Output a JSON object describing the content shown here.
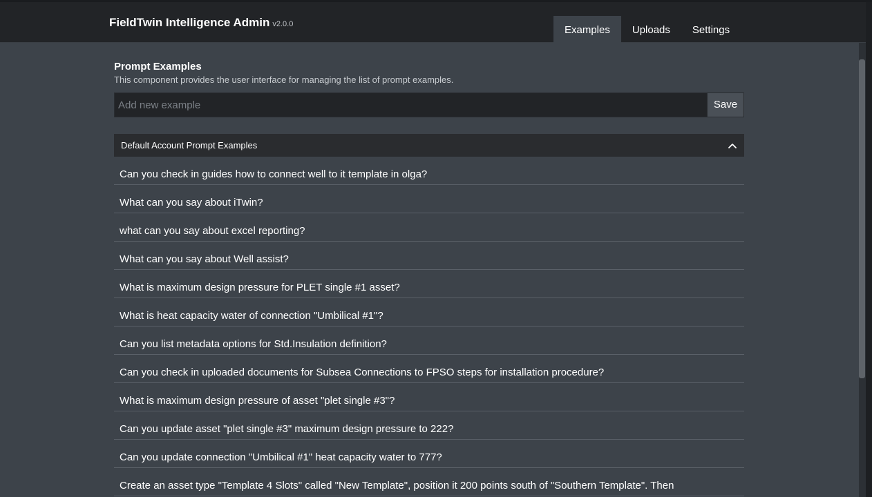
{
  "header": {
    "title": "FieldTwin Intelligence Admin",
    "version": "v2.0.0",
    "tabs": [
      {
        "label": "Examples",
        "active": true
      },
      {
        "label": "Uploads",
        "active": false
      },
      {
        "label": "Settings",
        "active": false
      }
    ]
  },
  "main": {
    "title": "Prompt Examples",
    "description": "This component provides the user interface for managing the list of prompt examples.",
    "input": {
      "placeholder": "Add new example",
      "value": ""
    },
    "save_label": "Save",
    "panel": {
      "title": "Default Account Prompt Examples",
      "toggle_icon": "chevron-up-icon",
      "items": [
        "Can you check in guides how to connect well to it template in olga?",
        "What can you say about iTwin?",
        "what can you say about excel reporting?",
        "What can you say about Well assist?",
        "What is maximum design pressure for PLET single #1 asset?",
        "What is heat capacity water of connection \"Umbilical #1\"?",
        "Can you list metadata options for Std.Insulation definition?",
        "Can you check in uploaded documents for Subsea Connections to FPSO steps for installation procedure?",
        "What is maximum design pressure of asset \"plet single #3\"?",
        "Can you update asset \"plet single #3\" maximum design pressure to 222?",
        "Can you update connection \"Umbilical #1\" heat capacity water to 777?",
        "Create an asset type \"Template 4 Slots\" called \"New Template\", position it 200 points south of \"Southern Template\". Then"
      ]
    }
  },
  "colors": {
    "background": "#3d434a",
    "header_bg": "#222427",
    "input_bg": "#222427",
    "panel_header_bg": "#2a2c2f",
    "divider": "#5a6068"
  }
}
